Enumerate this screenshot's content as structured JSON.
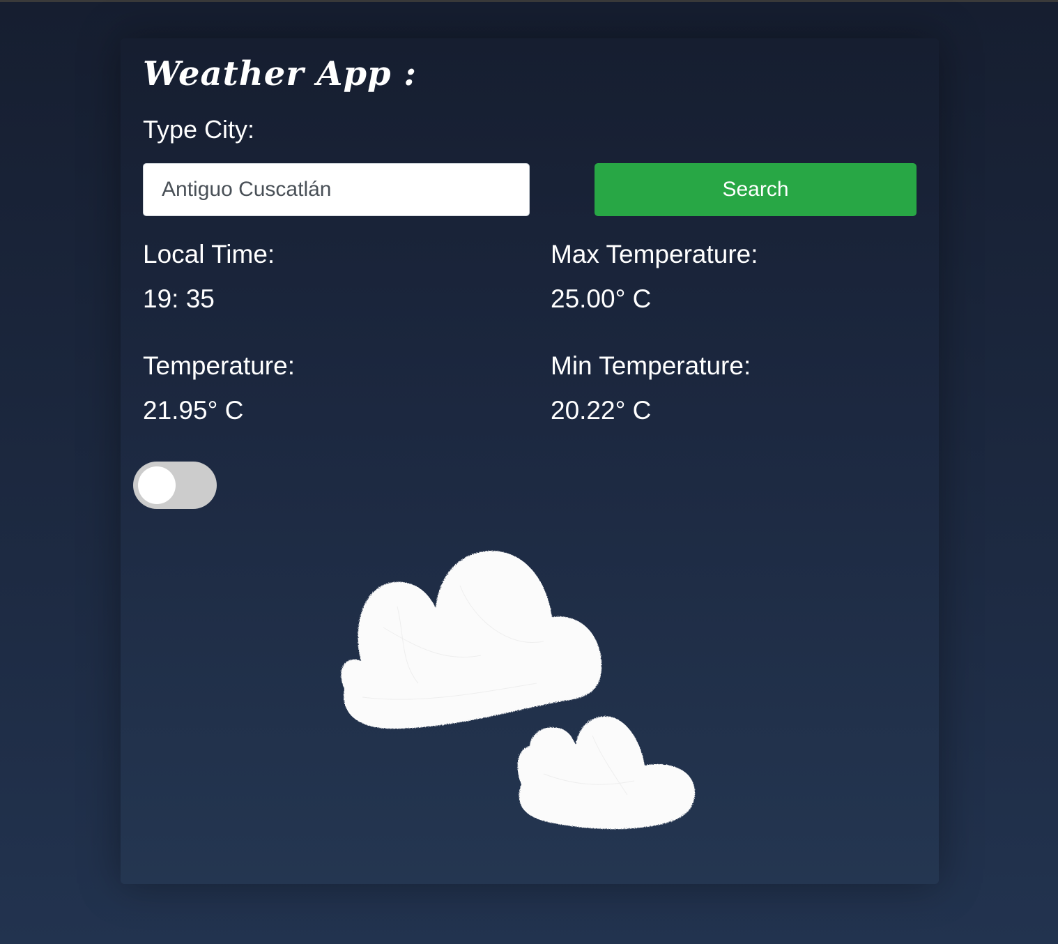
{
  "app": {
    "title": "Weather App :"
  },
  "search": {
    "label": "Type City:",
    "value": "Antiguo Cuscatlán",
    "button_label": "Search"
  },
  "stats": {
    "local_time": {
      "label": "Local Time:",
      "value": "19: 35"
    },
    "max_temperature": {
      "label": "Max Temperature:",
      "value": "25.00° C"
    },
    "temperature": {
      "label": "Temperature:",
      "value": "21.95° C"
    },
    "min_temperature": {
      "label": "Min Temperature:",
      "value": "20.22° C"
    }
  },
  "toggle": {
    "checked": false
  },
  "weather_icon": {
    "name": "clouds-icon"
  },
  "colors": {
    "search_button": "#28a745",
    "toggle_track": "#cccccc",
    "background_top": "#161e30",
    "background_bottom": "#243651"
  }
}
